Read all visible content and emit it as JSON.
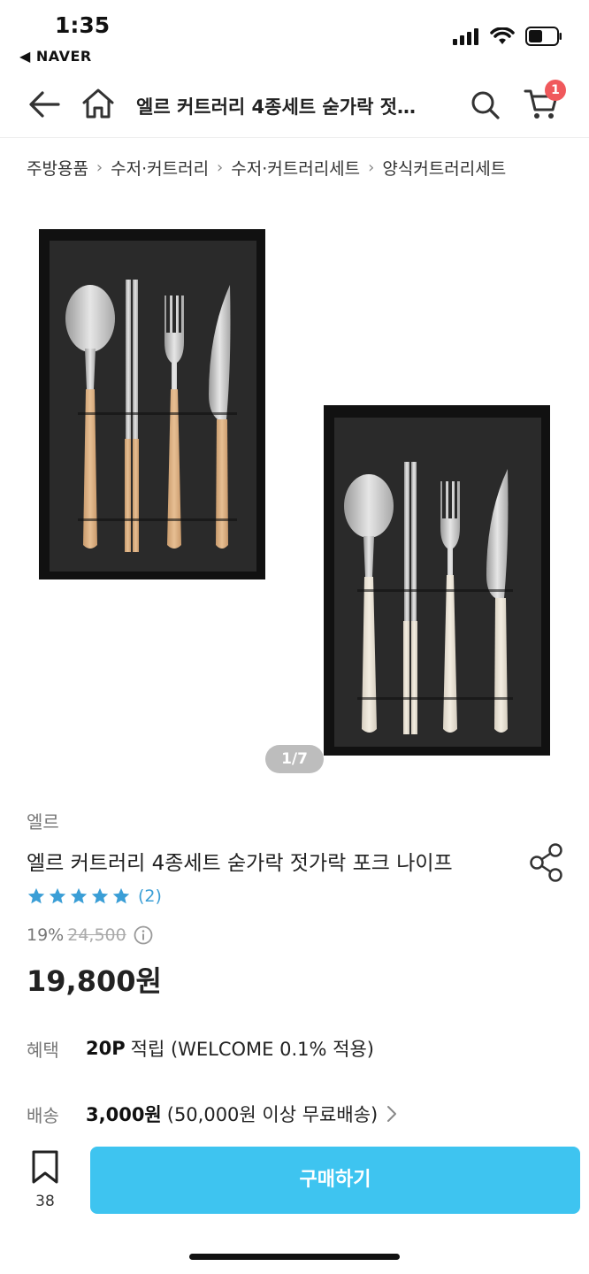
{
  "status_bar": {
    "time": "1:35",
    "back_app": "◀ NAVER"
  },
  "header": {
    "title": "엘르 커트러리 4종세트 숟가락 젓…",
    "cart_count": "1",
    "icons": [
      "back-arrow-icon",
      "home-icon",
      "search-icon",
      "cart-icon"
    ]
  },
  "breadcrumb": [
    "주방용품",
    "수저·커트러리",
    "수저·커트러리세트",
    "양식커트러리세트"
  ],
  "gallery": {
    "pager": "1/7"
  },
  "product": {
    "brand": "엘르",
    "name": "엘르 커트러리 4종세트 숟가락 젓가락 포크 나이프",
    "rating_stars": 5,
    "review_count": "(2)",
    "discount": "19%",
    "original_price": "24,500",
    "price": "19,800원"
  },
  "benefit": {
    "label": "혜택",
    "strong": "20P",
    "text": "적립 (WELCOME 0.1% 적용)"
  },
  "shipping": {
    "label": "배송",
    "strong": "3,000원",
    "text": "(50,000원 이상 무료배송)"
  },
  "bottom_bar": {
    "bookmark_count": "38",
    "buy_label": "구매하기"
  },
  "colors": {
    "accent": "#3ec4f0",
    "star": "#3a9ed6",
    "badge": "#f0595c"
  }
}
